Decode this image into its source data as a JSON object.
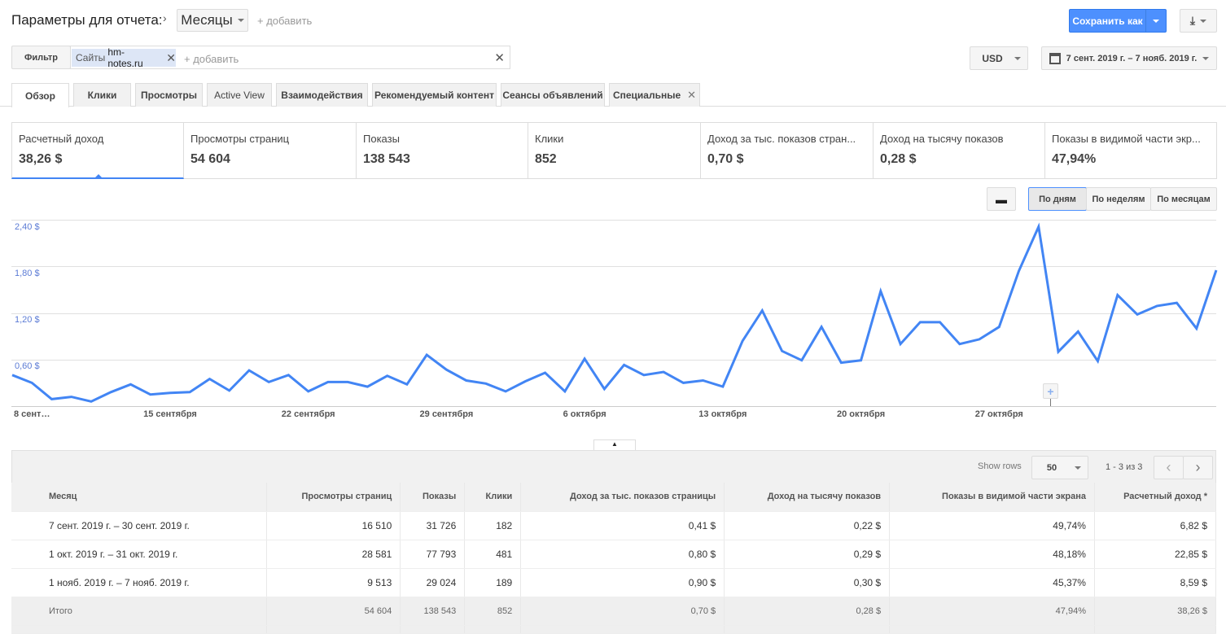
{
  "header": {
    "title": "Параметры для отчета:",
    "dimension": "Месяцы",
    "add_label": "+ добавить",
    "save_label": "Сохранить как"
  },
  "filter": {
    "button": "Фильтр",
    "chip_prefix": "Сайты",
    "chip_value": "hm-notes.ru",
    "add_placeholder": "+ добавить",
    "currency": "USD",
    "date_range": "7 сент. 2019 г. – 7 нояб. 2019 г."
  },
  "tabs": [
    "Обзор",
    "Клики",
    "Просмотры",
    "Active View",
    "Взаимодействия",
    "Рекомендуемый контент",
    "Сеансы объявлений",
    "Специальные"
  ],
  "metrics": [
    {
      "label": "Расчетный доход",
      "value": "38,26 $"
    },
    {
      "label": "Просмотры страниц",
      "value": "54 604"
    },
    {
      "label": "Показы",
      "value": "138 543"
    },
    {
      "label": "Клики",
      "value": "852"
    },
    {
      "label": "Доход за тыс. показов стран...",
      "value": "0,70 $"
    },
    {
      "label": "Доход на тысячу показов",
      "value": "0,28 $"
    },
    {
      "label": "Показы в видимой части экр...",
      "value": "47,94%"
    }
  ],
  "granularity": [
    "По дням",
    "По неделям",
    "По месяцам"
  ],
  "colors": {
    "accent": "#4285f4",
    "save": "#4d90fe"
  },
  "chart_data": {
    "type": "line",
    "title": "",
    "xlabel": "",
    "ylabel": "Расчетный доход",
    "ylim": [
      0,
      2.4
    ],
    "y_ticks": [
      "0,60 $",
      "1,20 $",
      "1,80 $",
      "2,40 $"
    ],
    "y_tick_values": [
      0.6,
      1.2,
      1.8,
      2.4
    ],
    "x_tick_labels": [
      "8 сент…",
      "15 сентября",
      "22 сентября",
      "29 сентября",
      "6 октября",
      "13 октября",
      "20 октября",
      "27 октября"
    ],
    "x_tick_days": [
      1,
      8,
      15,
      22,
      29,
      36,
      43,
      50
    ],
    "x_start": "7 сент. 2019",
    "x_end": "7 нояб. 2019",
    "series": [
      {
        "name": "Расчетный доход",
        "values": [
          0.4,
          0.3,
          0.09,
          0.12,
          0.06,
          0.18,
          0.28,
          0.15,
          0.17,
          0.18,
          0.35,
          0.2,
          0.46,
          0.31,
          0.4,
          0.19,
          0.31,
          0.31,
          0.25,
          0.39,
          0.28,
          0.66,
          0.47,
          0.33,
          0.29,
          0.19,
          0.32,
          0.43,
          0.19,
          0.61,
          0.22,
          0.53,
          0.4,
          0.44,
          0.3,
          0.33,
          0.25,
          0.84,
          1.23,
          0.71,
          0.59,
          1.02,
          0.56,
          0.59,
          1.48,
          0.8,
          1.08,
          1.08,
          0.8,
          0.86,
          1.02,
          1.74,
          2.31,
          0.7,
          0.96,
          0.58,
          1.43,
          1.18,
          1.29,
          1.33,
          1.0,
          1.75
        ]
      }
    ],
    "grid": true
  },
  "table": {
    "show_rows_label": "Show rows",
    "rows_value": "50",
    "pagination": "1 - 3 из 3",
    "columns": [
      "Месяц",
      "Просмотры страниц",
      "Показы",
      "Клики",
      "Доход за тыс. показов страницы",
      "Доход на тысячу показов",
      "Показы в видимой части экрана",
      "Расчетный доход *"
    ],
    "rows": [
      [
        "7 сент. 2019 г. – 30 сент. 2019 г.",
        "16 510",
        "31 726",
        "182",
        "0,41 $",
        "0,22 $",
        "49,74%",
        "6,82 $"
      ],
      [
        "1 окт. 2019 г. – 31 окт. 2019 г.",
        "28 581",
        "77 793",
        "481",
        "0,80 $",
        "0,29 $",
        "48,18%",
        "22,85 $"
      ],
      [
        "1 нояб. 2019 г. – 7 нояб. 2019 г.",
        "9 513",
        "29 024",
        "189",
        "0,90 $",
        "0,30 $",
        "45,37%",
        "8,59 $"
      ]
    ],
    "total": [
      "Итого",
      "54 604",
      "138 543",
      "852",
      "0,70 $",
      "0,28 $",
      "47,94%",
      "38,26 $"
    ]
  }
}
